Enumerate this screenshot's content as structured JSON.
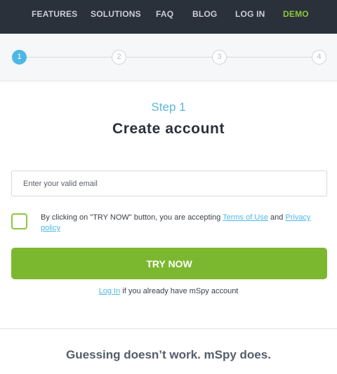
{
  "nav": {
    "items": [
      {
        "label": "FEATURES"
      },
      {
        "label": "SOLUTIONS"
      },
      {
        "label": "FAQ"
      },
      {
        "label": "BLOG"
      },
      {
        "label": "LOG IN"
      },
      {
        "label": "DEMO"
      }
    ],
    "demo_color": "#8cc63e"
  },
  "stepper": {
    "current_step": 1,
    "steps": [
      "1",
      "2",
      "3",
      "4"
    ]
  },
  "step_label": "Step 1",
  "title": "Create account",
  "email": {
    "placeholder": "Enter your valid email",
    "value": ""
  },
  "consent": {
    "checked": false,
    "text_before": "By clicking on \"TRY NOW\" button, you are accepting ",
    "terms_link": "Terms of Use",
    "text_middle": " and ",
    "privacy_link": "Privacy policy"
  },
  "cta": {
    "label": "TRY NOW",
    "color": "#7cb82f"
  },
  "login_prompt": {
    "link": "Log In",
    "text": " if you already have mSpy account"
  },
  "tagline": "Guessing doesn’t work. mSpy does.",
  "colors": {
    "accent_blue": "#4fb7e5",
    "nav_bg": "#2b313b"
  }
}
